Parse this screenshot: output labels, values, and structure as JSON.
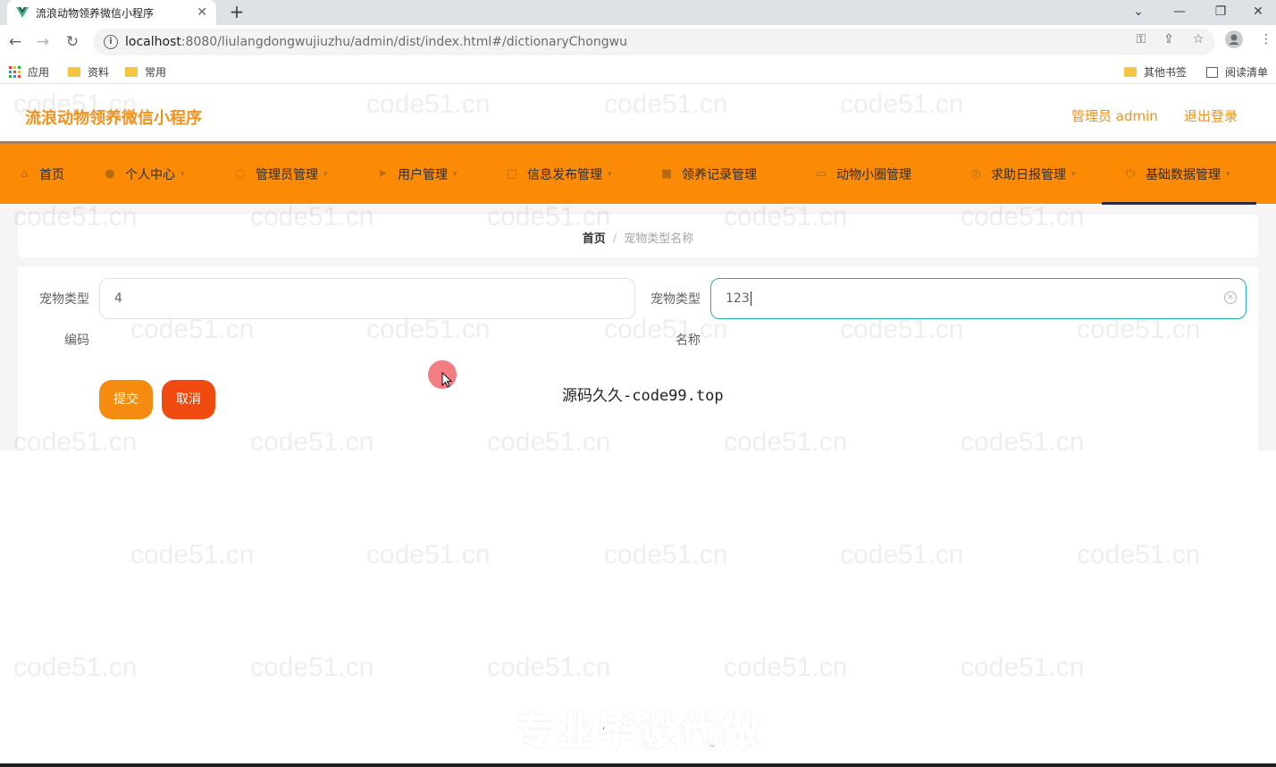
{
  "browser": {
    "tab_title": "流浪动物领养微信小程序",
    "url_host": "localhost",
    "url_path": ":8080/liulangdongwujiuzhu/admin/dist/index.html#/dictionaryChongwu",
    "bookmarks": [
      {
        "label": "应用",
        "icon": "apps-icon"
      },
      {
        "label": "资料",
        "icon": "folder-icon"
      },
      {
        "label": "常用",
        "icon": "folder-icon"
      }
    ],
    "bookmarks_right": [
      {
        "label": "其他书签",
        "icon": "folder-icon"
      },
      {
        "label": "阅读清单",
        "icon": "reading-list-icon"
      }
    ]
  },
  "header": {
    "app_title": "流浪动物领养微信小程序",
    "admin_label": "管理员 admin",
    "logout_label": "退出登录"
  },
  "nav": {
    "items": [
      {
        "label": "首页",
        "icon": "home-icon",
        "has_caret": false
      },
      {
        "label": "个人中心",
        "icon": "user-icon",
        "has_caret": true
      },
      {
        "label": "管理员管理",
        "icon": "mic-icon",
        "has_caret": true
      },
      {
        "label": "用户管理",
        "icon": "send-icon",
        "has_caret": true
      },
      {
        "label": "信息发布管理",
        "icon": "calendar-icon",
        "has_caret": true
      },
      {
        "label": "领养记录管理",
        "icon": "chat-icon",
        "has_caret": false
      },
      {
        "label": "动物小圈管理",
        "icon": "card-icon",
        "has_caret": false
      },
      {
        "label": "求助日报管理",
        "icon": "help-icon",
        "has_caret": true
      },
      {
        "label": "基础数据管理",
        "icon": "power-icon",
        "has_caret": true
      }
    ],
    "active_index": 8
  },
  "breadcrumb": {
    "home": "首页",
    "separator": "/",
    "current": "宠物类型名称"
  },
  "form": {
    "field1": {
      "label_line1": "宠物类型",
      "label_line2": "编码",
      "value": "4"
    },
    "field2": {
      "label_line1": "宠物类型",
      "label_line2": "名称",
      "value": "123"
    },
    "submit_label": "提交",
    "cancel_label": "取消"
  },
  "overlay": {
    "source_text": "源码久久-code99.top",
    "banner_text": "专业毕设代做",
    "watermark_text": "code51.cn"
  },
  "colors": {
    "brand_orange": "#fb8b05",
    "title_orange": "#f0921c",
    "submit": "#f58c0f",
    "cancel": "#f04a10",
    "focus_border": "#20b2aa"
  }
}
